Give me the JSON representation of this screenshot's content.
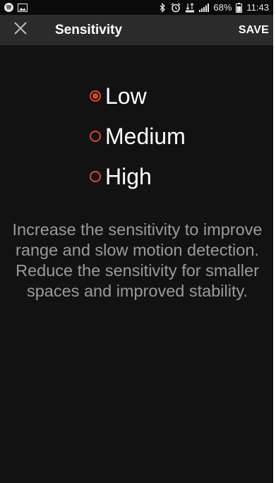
{
  "status_bar": {
    "battery_percent": "68%",
    "time": "11:43",
    "left_icons": [
      "spotify-icon",
      "image-icon"
    ],
    "right_icons": [
      "bluetooth-icon",
      "alarm-icon",
      "lte-icon",
      "signal-icon",
      "battery-icon"
    ]
  },
  "toolbar": {
    "title": "Sensitivity",
    "save_label": "SAVE",
    "close_icon": "close-icon"
  },
  "options": [
    {
      "label": "Low",
      "selected": true
    },
    {
      "label": "Medium",
      "selected": false
    },
    {
      "label": "High",
      "selected": false
    }
  ],
  "description": "Increase the sensitivity to improve range and slow motion detection. Reduce the sensitivity for smaller spaces and improved stability.",
  "colors": {
    "accent": "#e0452b",
    "background": "#121212",
    "toolbar": "#2b2b2b",
    "description_text": "#9a9a9a"
  }
}
